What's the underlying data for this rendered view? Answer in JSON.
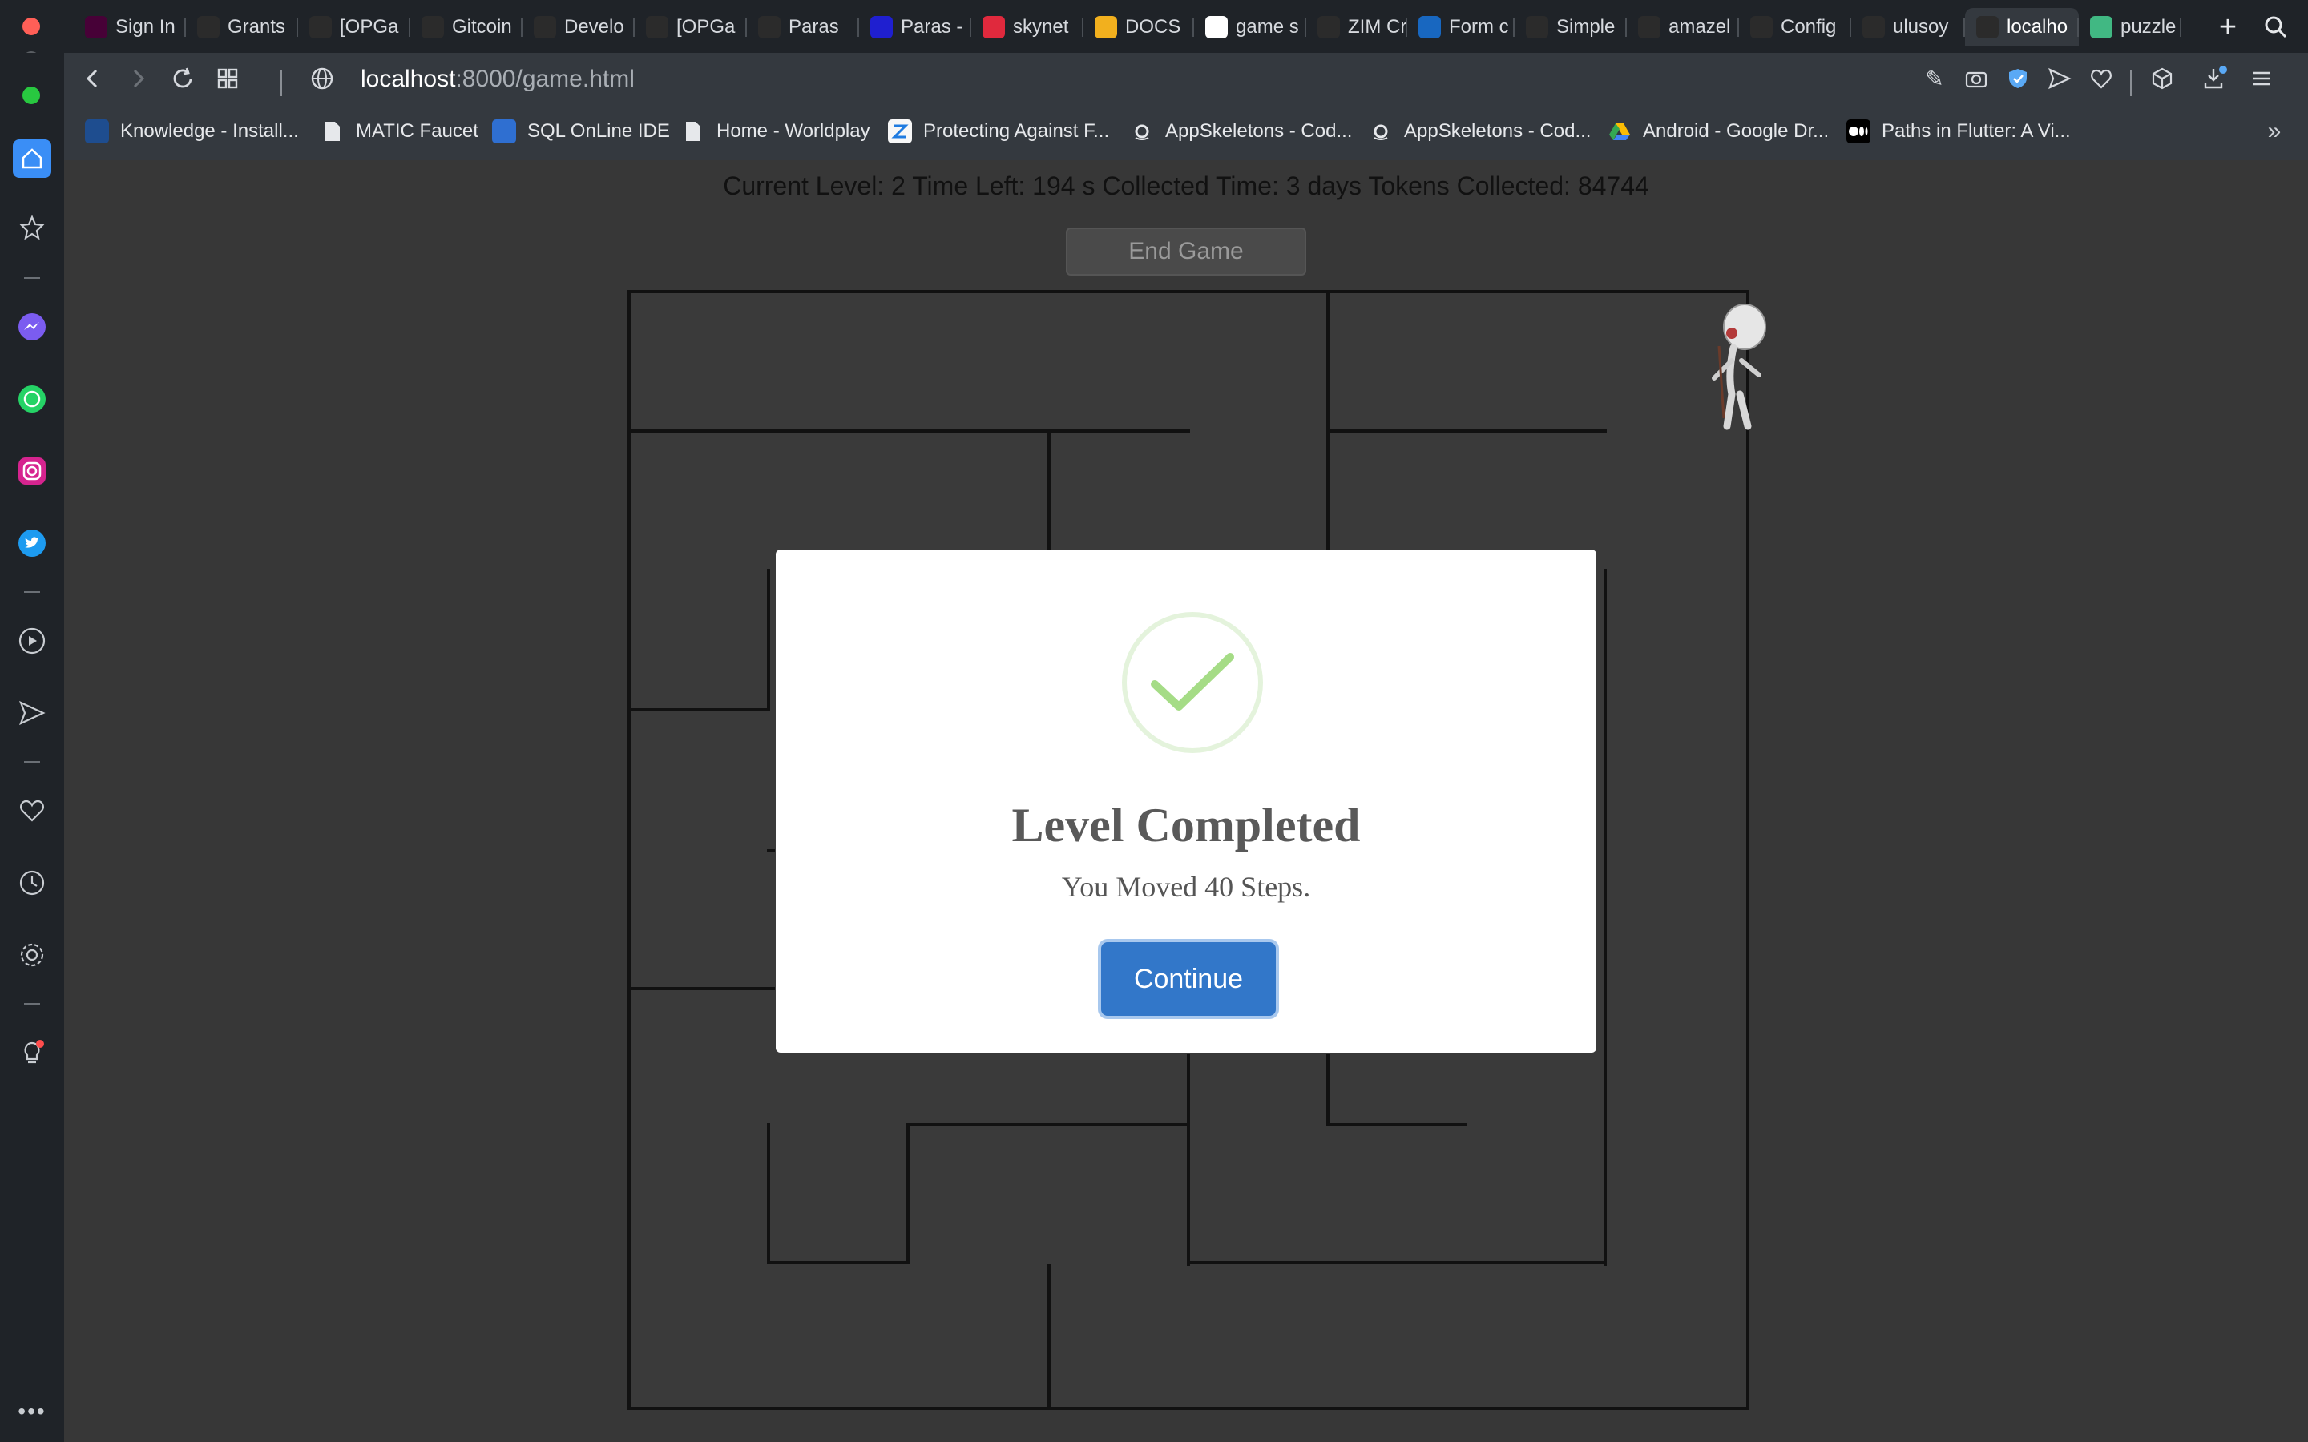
{
  "browser": {
    "tabs": [
      {
        "label": "Sign In",
        "icon": "xd-icon",
        "color": "#470137"
      },
      {
        "label": "Grants",
        "icon": "gitcoin-icon",
        "color": "#2b2b2b"
      },
      {
        "label": "[OPGa",
        "icon": "gitcoin-icon",
        "color": "#2b2b2b"
      },
      {
        "label": "Gitcoin",
        "icon": "gitcoin-icon",
        "color": "#2b2b2b"
      },
      {
        "label": "Develo",
        "icon": "github-icon",
        "color": "#2b2b2b"
      },
      {
        "label": "[OPGa",
        "icon": "gitcoin-icon",
        "color": "#2b2b2b"
      },
      {
        "label": "Paras",
        "icon": "github-icon",
        "color": "#2b2b2b"
      },
      {
        "label": "Paras -",
        "icon": "paras-icon",
        "color": "#1f1fd0"
      },
      {
        "label": "skynet",
        "icon": "skynet-icon",
        "color": "#e0293d"
      },
      {
        "label": "DOCS",
        "icon": "docs-icon",
        "color": "#f2b01e"
      },
      {
        "label": "game s",
        "icon": "google-icon",
        "color": "#ffffff"
      },
      {
        "label": "ZIM Cr",
        "icon": "zim-icon",
        "color": "#2b2b2b"
      },
      {
        "label": "Form c",
        "icon": "vuetify-icon",
        "color": "#1867c0"
      },
      {
        "label": "Simple",
        "icon": "codesandbox-icon",
        "color": "#2b2b2b"
      },
      {
        "label": "amazel",
        "icon": "github-icon",
        "color": "#2b2b2b"
      },
      {
        "label": "Config",
        "icon": "config-icon",
        "color": "#2b2b2b"
      },
      {
        "label": "ulusoy",
        "icon": "github-icon",
        "color": "#2b2b2b"
      },
      {
        "label": "localho",
        "icon": "file-icon",
        "color": "#2b2b2b",
        "active": true
      },
      {
        "label": "puzzle",
        "icon": "vue-icon",
        "color": "#41b883"
      }
    ],
    "url_host": "localhost",
    "url_path": ":8000/game.html",
    "bookmarks": [
      {
        "label": "Knowledge - Install...",
        "icon": "uci-icon"
      },
      {
        "label": "MATIC Faucet",
        "icon": "file-icon"
      },
      {
        "label": "SQL OnLine IDE",
        "icon": "sql-icon"
      },
      {
        "label": "Home - Worldplay",
        "icon": "file-icon"
      },
      {
        "label": "Protecting Against F...",
        "icon": "zeplin-icon"
      },
      {
        "label": "AppSkeletons - Cod...",
        "icon": "amazon-icon"
      },
      {
        "label": "AppSkeletons - Cod...",
        "icon": "amazon-icon"
      },
      {
        "label": "Android - Google Dr...",
        "icon": "drive-icon"
      },
      {
        "label": "Paths in Flutter: A Vi...",
        "icon": "medium-icon"
      }
    ]
  },
  "game": {
    "status_text": "Current Level: 2  Time Left: 194 s Collected Time: 3 days Tokens Collected: 84744",
    "end_button": "End Game"
  },
  "modal": {
    "title": "Level Completed",
    "message": "You Moved 40 Steps.",
    "continue_button": "Continue",
    "accent": "#3277c9",
    "check_color": "#a5dc86"
  }
}
